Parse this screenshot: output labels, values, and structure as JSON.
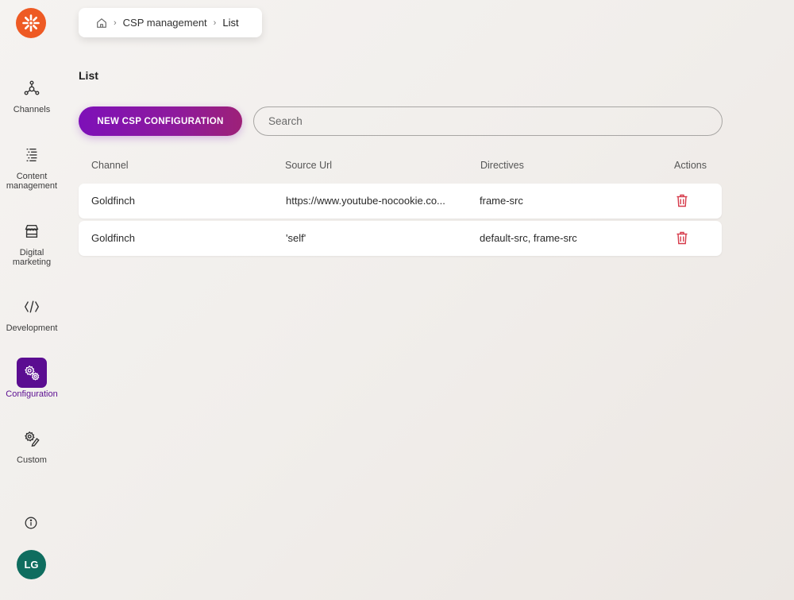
{
  "sidebar": {
    "logo": "kentico-logo",
    "items": [
      {
        "label": "Channels",
        "icon": "channels-icon",
        "active": false
      },
      {
        "label": "Content\nmanagement",
        "label_line1": "Content",
        "label_line2": "management",
        "icon": "content-management-icon",
        "active": false
      },
      {
        "label": "Digital\nmarketing",
        "label_line1": "Digital",
        "label_line2": "marketing",
        "icon": "digital-marketing-icon",
        "active": false
      },
      {
        "label": "Development",
        "icon": "code-icon",
        "active": false
      },
      {
        "label": "Configuration",
        "icon": "gears-icon",
        "active": true
      },
      {
        "label": "Custom",
        "icon": "custom-icon",
        "active": false
      }
    ],
    "avatar_initials": "LG",
    "colors": {
      "active": "#5b0d91",
      "logo": "#ee5a24",
      "avatar": "#0f6d5f"
    }
  },
  "breadcrumb": {
    "items": [
      "CSP management",
      "List"
    ]
  },
  "page": {
    "title": "List",
    "new_button_label": "NEW CSP CONFIGURATION",
    "search_placeholder": "Search",
    "search_value": ""
  },
  "table": {
    "columns": [
      "Channel",
      "Source Url",
      "Directives",
      "Actions"
    ],
    "rows": [
      {
        "channel": "Goldfinch",
        "source_url": "https://www.youtube-nocookie.co...",
        "directives": "frame-src",
        "action": "delete"
      },
      {
        "channel": "Goldfinch",
        "source_url": "'self'",
        "directives": "default-src, frame-src",
        "action": "delete"
      }
    ],
    "delete_color": "#d63a4a"
  }
}
